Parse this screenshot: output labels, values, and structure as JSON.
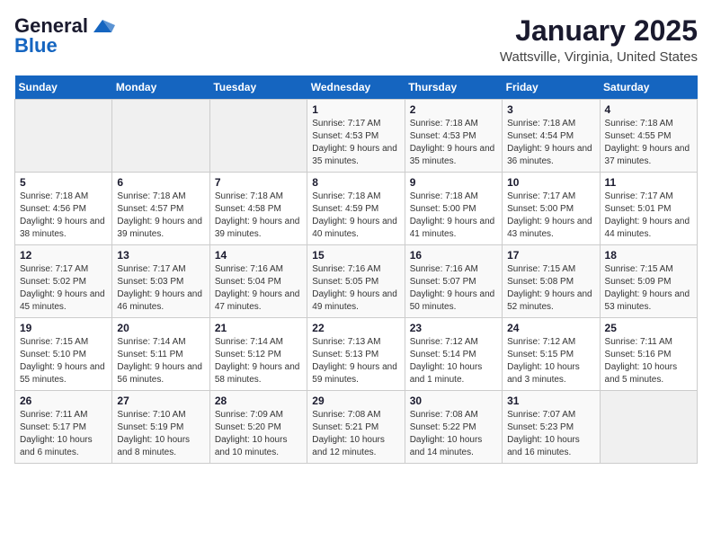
{
  "header": {
    "logo_general": "General",
    "logo_blue": "Blue",
    "calendar_title": "January 2025",
    "calendar_subtitle": "Wattsville, Virginia, United States"
  },
  "days_of_week": [
    "Sunday",
    "Monday",
    "Tuesday",
    "Wednesday",
    "Thursday",
    "Friday",
    "Saturday"
  ],
  "weeks": [
    [
      {
        "day": "",
        "info": ""
      },
      {
        "day": "",
        "info": ""
      },
      {
        "day": "",
        "info": ""
      },
      {
        "day": "1",
        "info": "Sunrise: 7:17 AM\nSunset: 4:53 PM\nDaylight: 9 hours and 35 minutes."
      },
      {
        "day": "2",
        "info": "Sunrise: 7:18 AM\nSunset: 4:53 PM\nDaylight: 9 hours and 35 minutes."
      },
      {
        "day": "3",
        "info": "Sunrise: 7:18 AM\nSunset: 4:54 PM\nDaylight: 9 hours and 36 minutes."
      },
      {
        "day": "4",
        "info": "Sunrise: 7:18 AM\nSunset: 4:55 PM\nDaylight: 9 hours and 37 minutes."
      }
    ],
    [
      {
        "day": "5",
        "info": "Sunrise: 7:18 AM\nSunset: 4:56 PM\nDaylight: 9 hours and 38 minutes."
      },
      {
        "day": "6",
        "info": "Sunrise: 7:18 AM\nSunset: 4:57 PM\nDaylight: 9 hours and 39 minutes."
      },
      {
        "day": "7",
        "info": "Sunrise: 7:18 AM\nSunset: 4:58 PM\nDaylight: 9 hours and 39 minutes."
      },
      {
        "day": "8",
        "info": "Sunrise: 7:18 AM\nSunset: 4:59 PM\nDaylight: 9 hours and 40 minutes."
      },
      {
        "day": "9",
        "info": "Sunrise: 7:18 AM\nSunset: 5:00 PM\nDaylight: 9 hours and 41 minutes."
      },
      {
        "day": "10",
        "info": "Sunrise: 7:17 AM\nSunset: 5:00 PM\nDaylight: 9 hours and 43 minutes."
      },
      {
        "day": "11",
        "info": "Sunrise: 7:17 AM\nSunset: 5:01 PM\nDaylight: 9 hours and 44 minutes."
      }
    ],
    [
      {
        "day": "12",
        "info": "Sunrise: 7:17 AM\nSunset: 5:02 PM\nDaylight: 9 hours and 45 minutes."
      },
      {
        "day": "13",
        "info": "Sunrise: 7:17 AM\nSunset: 5:03 PM\nDaylight: 9 hours and 46 minutes."
      },
      {
        "day": "14",
        "info": "Sunrise: 7:16 AM\nSunset: 5:04 PM\nDaylight: 9 hours and 47 minutes."
      },
      {
        "day": "15",
        "info": "Sunrise: 7:16 AM\nSunset: 5:05 PM\nDaylight: 9 hours and 49 minutes."
      },
      {
        "day": "16",
        "info": "Sunrise: 7:16 AM\nSunset: 5:07 PM\nDaylight: 9 hours and 50 minutes."
      },
      {
        "day": "17",
        "info": "Sunrise: 7:15 AM\nSunset: 5:08 PM\nDaylight: 9 hours and 52 minutes."
      },
      {
        "day": "18",
        "info": "Sunrise: 7:15 AM\nSunset: 5:09 PM\nDaylight: 9 hours and 53 minutes."
      }
    ],
    [
      {
        "day": "19",
        "info": "Sunrise: 7:15 AM\nSunset: 5:10 PM\nDaylight: 9 hours and 55 minutes."
      },
      {
        "day": "20",
        "info": "Sunrise: 7:14 AM\nSunset: 5:11 PM\nDaylight: 9 hours and 56 minutes."
      },
      {
        "day": "21",
        "info": "Sunrise: 7:14 AM\nSunset: 5:12 PM\nDaylight: 9 hours and 58 minutes."
      },
      {
        "day": "22",
        "info": "Sunrise: 7:13 AM\nSunset: 5:13 PM\nDaylight: 9 hours and 59 minutes."
      },
      {
        "day": "23",
        "info": "Sunrise: 7:12 AM\nSunset: 5:14 PM\nDaylight: 10 hours and 1 minute."
      },
      {
        "day": "24",
        "info": "Sunrise: 7:12 AM\nSunset: 5:15 PM\nDaylight: 10 hours and 3 minutes."
      },
      {
        "day": "25",
        "info": "Sunrise: 7:11 AM\nSunset: 5:16 PM\nDaylight: 10 hours and 5 minutes."
      }
    ],
    [
      {
        "day": "26",
        "info": "Sunrise: 7:11 AM\nSunset: 5:17 PM\nDaylight: 10 hours and 6 minutes."
      },
      {
        "day": "27",
        "info": "Sunrise: 7:10 AM\nSunset: 5:19 PM\nDaylight: 10 hours and 8 minutes."
      },
      {
        "day": "28",
        "info": "Sunrise: 7:09 AM\nSunset: 5:20 PM\nDaylight: 10 hours and 10 minutes."
      },
      {
        "day": "29",
        "info": "Sunrise: 7:08 AM\nSunset: 5:21 PM\nDaylight: 10 hours and 12 minutes."
      },
      {
        "day": "30",
        "info": "Sunrise: 7:08 AM\nSunset: 5:22 PM\nDaylight: 10 hours and 14 minutes."
      },
      {
        "day": "31",
        "info": "Sunrise: 7:07 AM\nSunset: 5:23 PM\nDaylight: 10 hours and 16 minutes."
      },
      {
        "day": "",
        "info": ""
      }
    ]
  ]
}
